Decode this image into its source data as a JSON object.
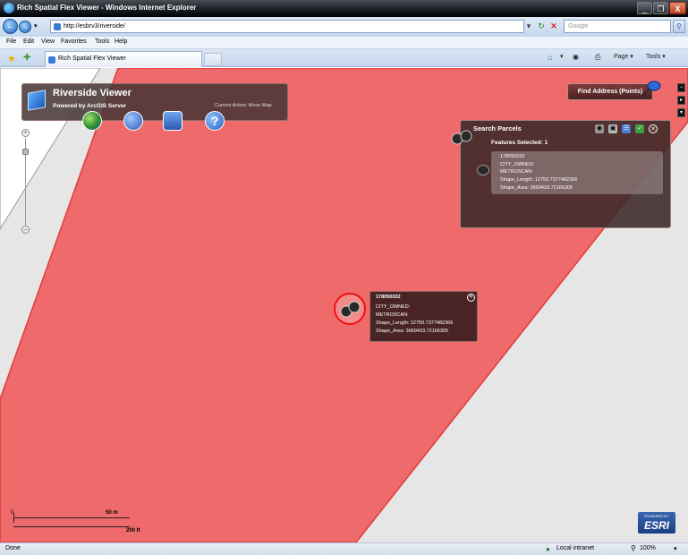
{
  "window": {
    "title": "Rich Spatial Flex Viewer - Windows Internet Explorer",
    "controls": [
      "_",
      "❐",
      "X"
    ]
  },
  "address_bar": {
    "url": "http://esbrv3/riverside/",
    "search_placeholder": "Google"
  },
  "menu": [
    "File",
    "Edit",
    "View",
    "Favorites",
    "Tools",
    "Help"
  ],
  "tabs": [
    {
      "label": "Rich Spatial Flex Viewer"
    }
  ],
  "command_bar": {
    "page": "Page ▾",
    "tools": "Tools ▾"
  },
  "app": {
    "title": "Riverside Viewer",
    "subtitle": "Powered by ArcGIS Server",
    "current_action": "Current Action: Move Map",
    "find_address_label": "Find Address (Points)"
  },
  "search_parcels": {
    "title": "Search Parcels",
    "features_selected": "Features Selected: 1",
    "result": {
      "id": "178050032",
      "city_owned": "CITY_OWNED:",
      "metroscan": "METROSCAN:",
      "shape_length": "Shape_Length: 12750.7377482366",
      "shape_area": "Shape_Area: 3669433.72166305"
    }
  },
  "popup": {
    "id": "178050032",
    "city_owned": "CITY_OWNED:",
    "metroscan": "METROSCAN:",
    "shape_length": "Shape_Length: 12750.7377482366",
    "shape_area": "Shape_Area: 3669433.72166305"
  },
  "scale": {
    "zero": "0",
    "metric": "50 m",
    "imperial": "200 ft"
  },
  "esri": {
    "powered_by": "POWERED BY",
    "name": "ESRI"
  },
  "status": {
    "left": "Done",
    "zone": "Local intranet",
    "zoom": "100%"
  },
  "colors": {
    "parcel_fill": "#ef6b6b",
    "parcel_stroke": "#e23a3a",
    "panel": "#4a2424"
  }
}
